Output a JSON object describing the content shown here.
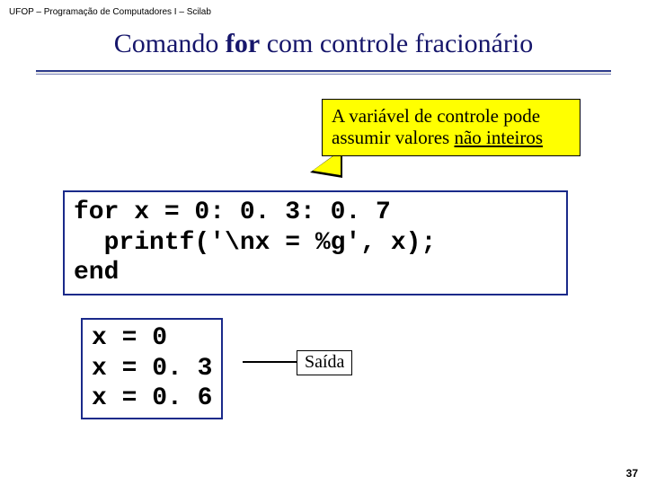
{
  "header_note": "UFOP – Programação de Computadores I – Scilab",
  "title": {
    "pre": "Comando ",
    "bold": "for",
    "post": " com controle fracionário"
  },
  "callout": {
    "line1": "A variável de controle pode",
    "line2_pre": "assumir valores ",
    "line2_underlined": "não inteiros"
  },
  "code": {
    "line1": "for x = 0: 0. 3: 0. 7",
    "line2": "  printf('\\nx = %g', x);",
    "line3": "end"
  },
  "output": {
    "line1": "x = 0",
    "line2": "x = 0. 3",
    "line3": "x = 0. 6"
  },
  "saida_label": "Saída",
  "page_number": "37"
}
